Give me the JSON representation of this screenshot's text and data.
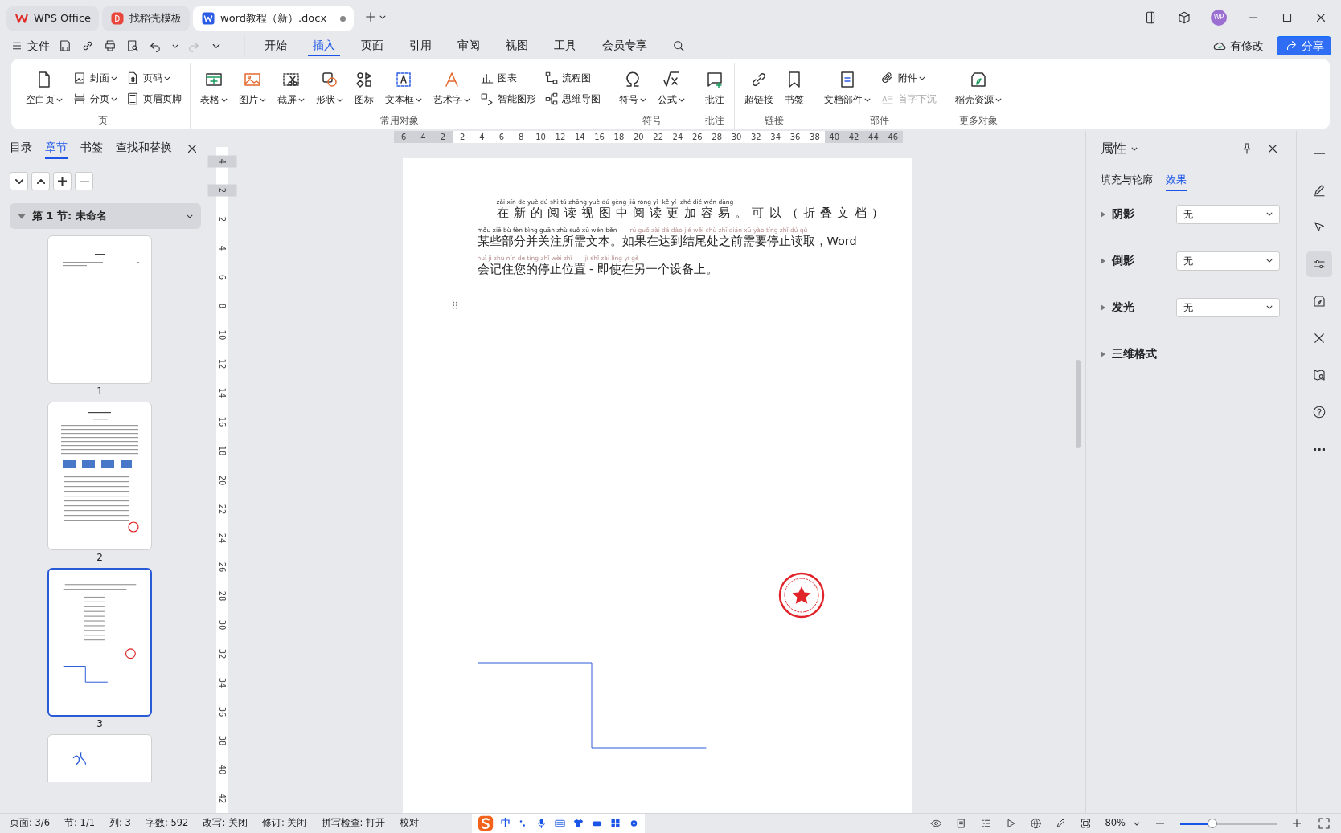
{
  "tabs": [
    {
      "label": "WPS Office",
      "kind": "wps",
      "selected": false
    },
    {
      "label": "找稻壳模板",
      "kind": "docer",
      "selected": false
    },
    {
      "label": "word教程（新）.docx",
      "kind": "doc",
      "selected": true
    }
  ],
  "user": {
    "initials": "WP"
  },
  "menu": {
    "file": "文件",
    "tabs": [
      {
        "label": "开始",
        "selected": false
      },
      {
        "label": "插入",
        "selected": true
      },
      {
        "label": "页面",
        "selected": false
      },
      {
        "label": "引用",
        "selected": false
      },
      {
        "label": "审阅",
        "selected": false
      },
      {
        "label": "视图",
        "selected": false
      },
      {
        "label": "工具",
        "selected": false
      },
      {
        "label": "会员专享",
        "selected": false
      }
    ],
    "save_state": "有修改",
    "share": "分享"
  },
  "ribbon": [
    {
      "label": "页",
      "columns": [
        [
          {
            "label": "空白页",
            "dropdown": true,
            "disabled": false
          }
        ],
        [
          {
            "label": "封面",
            "dropdown": true,
            "disabled": false
          },
          {
            "label": "分页",
            "dropdown": true,
            "disabled": false
          }
        ],
        [
          {
            "label": "页码",
            "dropdown": true,
            "disabled": false
          },
          {
            "label": "页眉页脚",
            "dropdown": false,
            "disabled": false
          }
        ]
      ]
    },
    {
      "label": "常用对象",
      "columns": [
        [
          {
            "label": "表格",
            "dropdown": true,
            "disabled": false
          }
        ],
        [
          {
            "label": "图片",
            "dropdown": true,
            "disabled": false
          }
        ],
        [
          {
            "label": "截屏",
            "dropdown": true,
            "disabled": false
          }
        ],
        [
          {
            "label": "形状",
            "dropdown": true,
            "disabled": false
          }
        ],
        [
          {
            "label": "图标",
            "dropdown": false,
            "disabled": false
          }
        ],
        [
          {
            "label": "文本框",
            "dropdown": true,
            "disabled": false
          }
        ],
        [
          {
            "label": "艺术字",
            "dropdown": true,
            "disabled": false
          }
        ],
        [
          {
            "label": "图表",
            "dropdown": false,
            "disabled": false
          },
          {
            "label": "智能图形",
            "dropdown": false,
            "disabled": false
          }
        ],
        [
          {
            "label": "流程图",
            "dropdown": false,
            "disabled": false
          },
          {
            "label": "思维导图",
            "dropdown": false,
            "disabled": false
          }
        ]
      ]
    },
    {
      "label": "符号",
      "columns": [
        [
          {
            "label": "符号",
            "dropdown": true,
            "disabled": false
          }
        ],
        [
          {
            "label": "公式",
            "dropdown": true,
            "disabled": false
          }
        ]
      ]
    },
    {
      "label": "批注",
      "columns": [
        [
          {
            "label": "批注",
            "dropdown": false,
            "disabled": false
          }
        ]
      ]
    },
    {
      "label": "链接",
      "columns": [
        [
          {
            "label": "超链接",
            "dropdown": false,
            "disabled": false
          }
        ],
        [
          {
            "label": "书签",
            "dropdown": false,
            "disabled": false
          }
        ]
      ]
    },
    {
      "label": "部件",
      "columns": [
        [
          {
            "label": "文档部件",
            "dropdown": true,
            "disabled": false
          }
        ],
        [
          {
            "label": "附件",
            "dropdown": true,
            "disabled": false
          },
          {
            "label": "首字下沉",
            "dropdown": false,
            "disabled": true
          }
        ]
      ]
    },
    {
      "label": "更多对象",
      "columns": [
        [
          {
            "label": "稻壳资源",
            "dropdown": true,
            "disabled": false
          }
        ]
      ]
    }
  ],
  "left_panel": {
    "tabs": [
      {
        "label": "目录",
        "selected": false
      },
      {
        "label": "章节",
        "selected": true
      },
      {
        "label": "书签",
        "selected": false
      },
      {
        "label": "查找和替换",
        "selected": false
      }
    ],
    "section": {
      "label": "第 1 节: 未命名",
      "expanded": true
    },
    "pages": [
      {
        "number": "1",
        "selected": false
      },
      {
        "number": "2",
        "selected": false
      },
      {
        "number": "3",
        "selected": true
      },
      {
        "selected": false
      }
    ]
  },
  "ruler": {
    "horizontal": [
      "6",
      "4",
      "2",
      "2",
      "4",
      "6",
      "8",
      "10",
      "12",
      "14",
      "16",
      "18",
      "20",
      "22",
      "24",
      "26",
      "28",
      "30",
      "32",
      "34",
      "36",
      "38",
      "40",
      "42",
      "44",
      "46"
    ],
    "vertical": [
      "4",
      "2",
      "2",
      "4",
      "6",
      "8",
      "10",
      "12",
      "14",
      "16",
      "18",
      "20",
      "22",
      "24",
      "26",
      "28",
      "30",
      "32",
      "34",
      "36",
      "38",
      "40",
      "42"
    ]
  },
  "document": {
    "lines": [
      {
        "spaced": true,
        "pinyin": [
          {
            "text": "zài xīn de yuè dú shì tú zhōng yuè dú gèng jiā róng yì  kě yǐ  zhé dié wén dàng",
            "faint": false
          }
        ],
        "text": "在新的阅读视图中阅读更加容易。可以（折叠文档）"
      },
      {
        "spaced": false,
        "pinyin": [
          {
            "text": "mǒu xiē bù fèn bìng guān zhù suǒ xū wén běn",
            "faint": false
          },
          {
            "text": "rú guǒ zài dá dào jié wěi chù zhī qián xū yào tíng zhǐ dú qǔ",
            "faint": true
          }
        ],
        "text": "某些部分并关注所需文本。如果在达到结尾处之前需要停止读取，Word"
      },
      {
        "spaced": false,
        "pinyin": [
          {
            "text": "huì jì zhù nín de tíng zhǐ wèi zhì",
            "faint": true
          },
          {
            "text": "jí shǐ zài lìng yí gè",
            "faint": true
          }
        ],
        "text": "会记住您的停止位置 - 即使在另一个设备上。"
      }
    ]
  },
  "properties": {
    "title": "属性",
    "tabs": [
      {
        "label": "填充与轮廓",
        "selected": false
      },
      {
        "label": "效果",
        "selected": true
      }
    ],
    "rows": [
      {
        "kind": "select",
        "label": "阴影",
        "value": "无"
      },
      {
        "kind": "select",
        "label": "倒影",
        "value": "无"
      },
      {
        "kind": "select",
        "label": "发光",
        "value": "无"
      },
      {
        "kind": "header",
        "label": "三维格式"
      }
    ]
  },
  "status_bar": {
    "items": [
      "页面: 3/6",
      "节: 1/1",
      "列: 3",
      "字数: 592",
      "改写: 关闭",
      "修订: 关闭",
      "拼写检查: 打开",
      "校对"
    ],
    "ime": "中",
    "zoom": "80%",
    "zoom_slider": {
      "level": 0.33
    }
  }
}
